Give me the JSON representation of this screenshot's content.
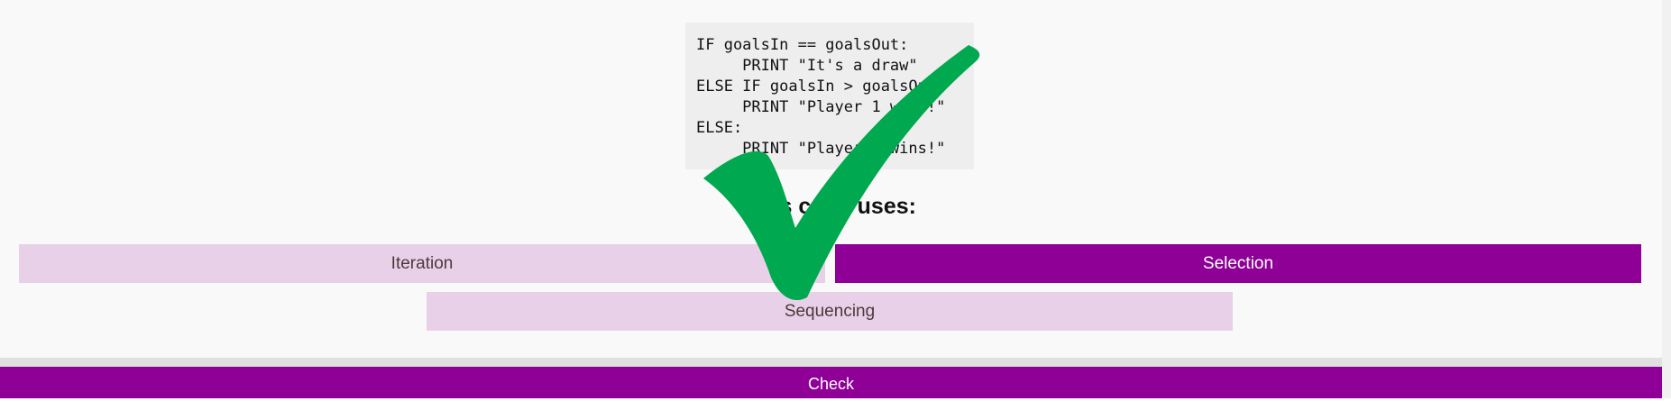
{
  "code": {
    "lines": [
      "IF goalsIn == goalsOut:",
      "     PRINT \"It's a draw\"",
      "ELSE IF goalsIn > goalsOut:",
      "     PRINT \"Player 1 wins!\"",
      "ELSE:",
      "     PRINT \"Player 2 wins!\""
    ]
  },
  "question": {
    "text": "This code uses:"
  },
  "options": [
    {
      "label": "Iteration",
      "selected": false
    },
    {
      "label": "Selection",
      "selected": true
    },
    {
      "label": "Sequencing",
      "selected": false
    }
  ],
  "check_button": {
    "label": "Check"
  },
  "feedback": {
    "icon": "checkmark-icon",
    "state": "correct",
    "color": "#00a84f"
  },
  "colors": {
    "accent": "#8e0096",
    "option_unselected": "#e8d1e8",
    "panel_background": "#f9f9f9",
    "code_background": "#eeeeee"
  }
}
